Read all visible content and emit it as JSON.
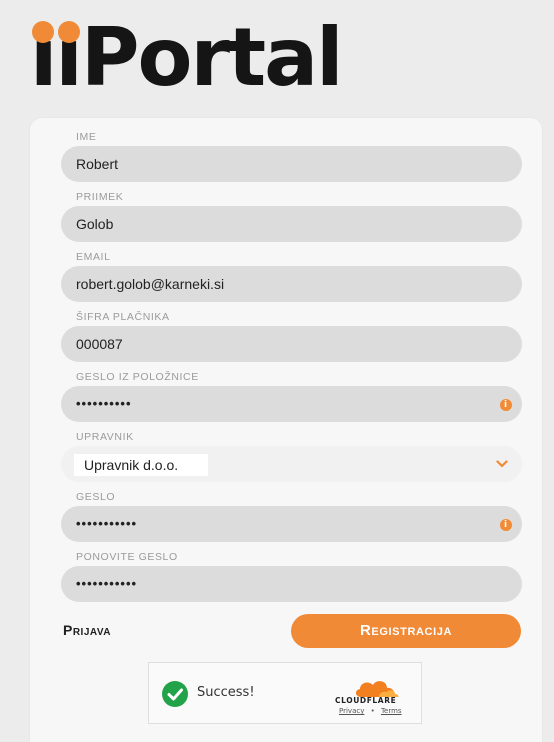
{
  "brand": {
    "logo_text": "iiPortal",
    "accent": "#f08a36"
  },
  "form": {
    "fields": [
      {
        "label": "Ime",
        "value": "Robert"
      },
      {
        "label": "Priimek",
        "value": "Golob"
      },
      {
        "label": "Email",
        "value": "robert.golob@karneki.si"
      },
      {
        "label": "Šifra plačnika",
        "value": "000087"
      },
      {
        "label": "Geslo iz položnice",
        "value": "••••••••••"
      },
      {
        "label": "Upravnik",
        "value": "Upravnik d.o.o."
      },
      {
        "label": "Geslo",
        "value": "•••••••••••"
      },
      {
        "label": "Ponovite geslo",
        "value": "•••••••••••"
      }
    ],
    "info_icon": "i",
    "login_link": "Prijava",
    "submit_label": "Registracija"
  },
  "captcha": {
    "status": "Success!",
    "provider": "CLOUDFLARE",
    "privacy_link": "Privacy",
    "separator": "•",
    "terms_link": "Terms"
  }
}
